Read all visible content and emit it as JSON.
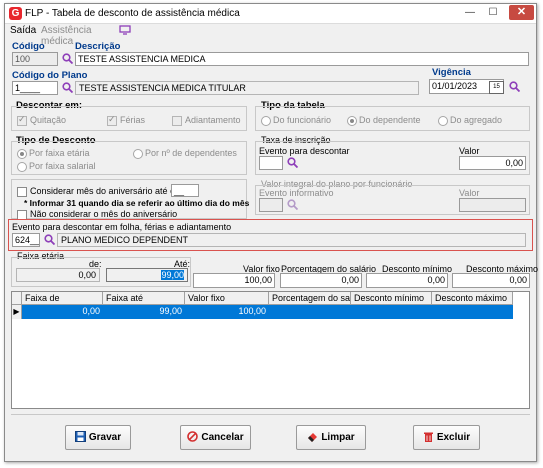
{
  "window": {
    "title": "FLP - Tabela de desconto de assistência médica",
    "minimize": "—",
    "maximize": "☐",
    "close": "✕"
  },
  "menu": {
    "exit": "Saída",
    "assistance": "Assistência médica"
  },
  "codigo": {
    "label": "Código",
    "value": "100"
  },
  "descricao": {
    "label": "Descrição",
    "value": "TESTE ASSISTENCIA MEDICA"
  },
  "codigo_plano": {
    "label": "Código do Plano",
    "value": "1____",
    "description": "TESTE ASSISTENCIA MEDICA TITULAR"
  },
  "vigencia": {
    "label": "Vigência",
    "value": "01/01/2023",
    "calendar": "15"
  },
  "descontar_em": {
    "label": "Descontar em:",
    "options": [
      "Quitação",
      "Férias",
      "Adiantamento"
    ]
  },
  "tipo_tabela": {
    "label": "Tipo da tabela",
    "options": [
      "Do funcionário",
      "Do dependente",
      "Do agregado"
    ]
  },
  "tipo_desconto": {
    "label": "Tipo de Desconto",
    "options": [
      "Por faixa etária",
      "Por nº de dependentes",
      "Por faixa salarial"
    ]
  },
  "taxa_inscricao": {
    "label": "Taxa de inscrição",
    "evento_label": "Evento para descontar",
    "valor_label": "Valor",
    "valor": "0,00"
  },
  "aniversario": {
    "label": "Considerar mês do aniversário até o dia",
    "day": "__",
    "note": "* Informar 31 quando dia se referir ao último dia do mês",
    "no_month": "Não considerar o mês do aniversário"
  },
  "valor_integral": {
    "label": "Valor integral do plano por funcionário",
    "evento_label": "Evento informativo",
    "valor_label": "Valor"
  },
  "evento_folha": {
    "label": "Evento para descontar em folha, férias e adiantamento",
    "code": "624__",
    "description": "PLANO MEDICO DEPENDENT"
  },
  "faixa": {
    "label": "Faixa etária",
    "de_label": "de:",
    "ate_label": "Até:",
    "de": "0,00",
    "ate": "99,00",
    "valor_fixo_label": "Valor fixo",
    "valor_fixo": "100,00",
    "pct_label": "Porcentagem do salário",
    "pct": "0,00",
    "min_label": "Desconto mínimo",
    "min": "0,00",
    "max_label": "Desconto máximo",
    "max": "0,00"
  },
  "table": {
    "columns": [
      "Faixa de",
      "Faixa até",
      "Valor fixo",
      "Porcentagem do salário",
      "Desconto mínimo",
      "Desconto máximo"
    ],
    "rows": [
      [
        "0,00",
        "99,00",
        "100,00",
        "",
        "",
        ""
      ]
    ]
  },
  "buttons": {
    "save": "Gravar",
    "cancel": "Cancelar",
    "clear": "Limpar",
    "delete": "Excluir"
  },
  "colors": {
    "accent": "#003a8c",
    "selection": "#0078d7",
    "search": "#8e3fb9"
  }
}
